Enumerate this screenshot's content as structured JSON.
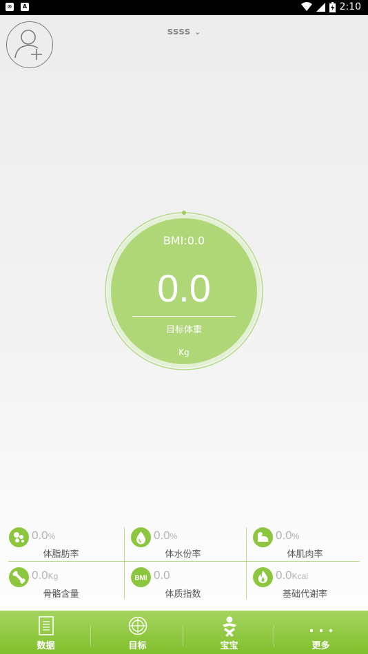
{
  "status_bar": {
    "time": "2:10",
    "left_icons": [
      "chrome-notification-icon",
      "a-notification-icon"
    ]
  },
  "header": {
    "user_name": "ssss"
  },
  "gauge": {
    "bmi_text": "BMI:0.0",
    "weight_value": "0.0",
    "label": "目标体重",
    "unit": "Kg",
    "color": "#afd778"
  },
  "stats": [
    {
      "icon": "dots-icon",
      "value": "0.0",
      "unit": "%",
      "label": "体脂肪率"
    },
    {
      "icon": "water-drop-icon",
      "value": "0.0",
      "unit": "%",
      "label": "体水份率"
    },
    {
      "icon": "muscle-arm-icon",
      "value": "0.0",
      "unit": "%",
      "label": "体肌肉率"
    },
    {
      "icon": "bone-icon",
      "value": "0.0",
      "unit": "Kg",
      "label": "骨骼含量"
    },
    {
      "icon": "bmi-badge-icon",
      "value": "0.0",
      "unit": "",
      "label": "体质指数",
      "badge_text": "BMI"
    },
    {
      "icon": "flame-icon",
      "value": "0.0",
      "unit": "Kcal",
      "label": "基础代谢率"
    }
  ],
  "tabs": [
    {
      "icon": "document-icon",
      "label": "数据"
    },
    {
      "icon": "target-icon",
      "label": "目标"
    },
    {
      "icon": "baby-icon",
      "label": "宝宝"
    },
    {
      "icon": "more-dots-icon",
      "label": "更多"
    }
  ],
  "colors": {
    "accent": "#8cc63e",
    "tabbar": "#8dc63f",
    "divider": "#b7dc8e"
  }
}
